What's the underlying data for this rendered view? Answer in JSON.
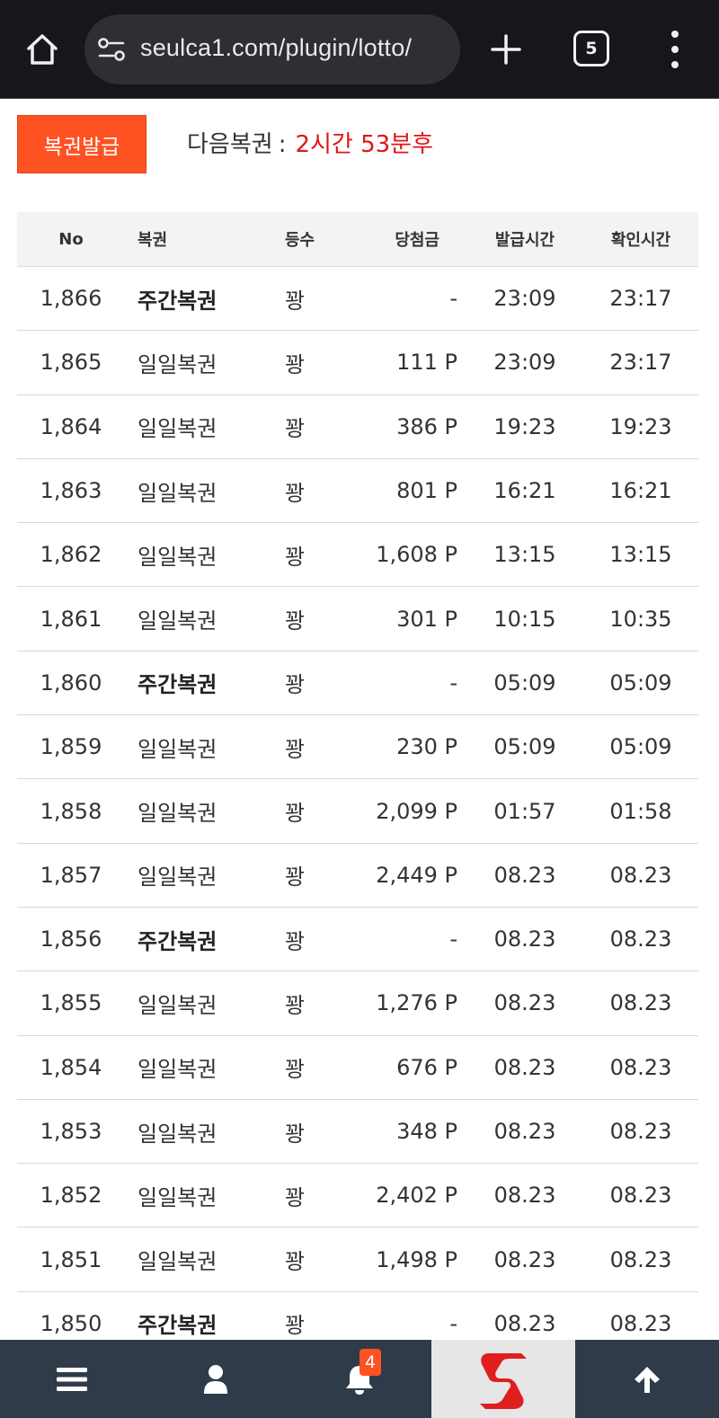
{
  "browser": {
    "url": "seulca1.com/plugin/lotto/",
    "tab_count": "5"
  },
  "page": {
    "issue_button": "복권발급",
    "next_label": "다음복권",
    "next_colon": ":",
    "next_time": "2시간 53분후"
  },
  "table": {
    "headers": {
      "no": "No",
      "type": "복권",
      "rank": "등수",
      "prize": "당첨금",
      "issued": "발급시간",
      "checked": "확인시간"
    },
    "rows": [
      {
        "no": "1,866",
        "type": "주간복권",
        "rank": "꽝",
        "prize": "-",
        "issued": "23:09",
        "checked": "23:17",
        "bold": true
      },
      {
        "no": "1,865",
        "type": "일일복권",
        "rank": "꽝",
        "prize": "111 P",
        "issued": "23:09",
        "checked": "23:17",
        "bold": false
      },
      {
        "no": "1,864",
        "type": "일일복권",
        "rank": "꽝",
        "prize": "386 P",
        "issued": "19:23",
        "checked": "19:23",
        "bold": false
      },
      {
        "no": "1,863",
        "type": "일일복권",
        "rank": "꽝",
        "prize": "801 P",
        "issued": "16:21",
        "checked": "16:21",
        "bold": false
      },
      {
        "no": "1,862",
        "type": "일일복권",
        "rank": "꽝",
        "prize": "1,608 P",
        "issued": "13:15",
        "checked": "13:15",
        "bold": false
      },
      {
        "no": "1,861",
        "type": "일일복권",
        "rank": "꽝",
        "prize": "301 P",
        "issued": "10:15",
        "checked": "10:35",
        "bold": false
      },
      {
        "no": "1,860",
        "type": "주간복권",
        "rank": "꽝",
        "prize": "-",
        "issued": "05:09",
        "checked": "05:09",
        "bold": true
      },
      {
        "no": "1,859",
        "type": "일일복권",
        "rank": "꽝",
        "prize": "230 P",
        "issued": "05:09",
        "checked": "05:09",
        "bold": false
      },
      {
        "no": "1,858",
        "type": "일일복권",
        "rank": "꽝",
        "prize": "2,099 P",
        "issued": "01:57",
        "checked": "01:58",
        "bold": false
      },
      {
        "no": "1,857",
        "type": "일일복권",
        "rank": "꽝",
        "prize": "2,449 P",
        "issued": "08.23",
        "checked": "08.23",
        "bold": false
      },
      {
        "no": "1,856",
        "type": "주간복권",
        "rank": "꽝",
        "prize": "-",
        "issued": "08.23",
        "checked": "08.23",
        "bold": true
      },
      {
        "no": "1,855",
        "type": "일일복권",
        "rank": "꽝",
        "prize": "1,276 P",
        "issued": "08.23",
        "checked": "08.23",
        "bold": false
      },
      {
        "no": "1,854",
        "type": "일일복권",
        "rank": "꽝",
        "prize": "676 P",
        "issued": "08.23",
        "checked": "08.23",
        "bold": false
      },
      {
        "no": "1,853",
        "type": "일일복권",
        "rank": "꽝",
        "prize": "348 P",
        "issued": "08.23",
        "checked": "08.23",
        "bold": false
      },
      {
        "no": "1,852",
        "type": "일일복권",
        "rank": "꽝",
        "prize": "2,402 P",
        "issued": "08.23",
        "checked": "08.23",
        "bold": false
      },
      {
        "no": "1,851",
        "type": "일일복권",
        "rank": "꽝",
        "prize": "1,498 P",
        "issued": "08.23",
        "checked": "08.23",
        "bold": false
      },
      {
        "no": "1,850",
        "type": "주간복권",
        "rank": "꽝",
        "prize": "-",
        "issued": "08.23",
        "checked": "08.23",
        "bold": true
      }
    ]
  },
  "bottom_nav": {
    "notification_count": "4",
    "items": [
      "menu-icon",
      "user-icon",
      "bell-icon",
      "site-logo",
      "arrow-up-icon"
    ]
  },
  "colors": {
    "accent": "#ff5223",
    "countdown": "#e31414",
    "nav_bg": "#2f3b48",
    "chrome_bg": "#16161b"
  }
}
